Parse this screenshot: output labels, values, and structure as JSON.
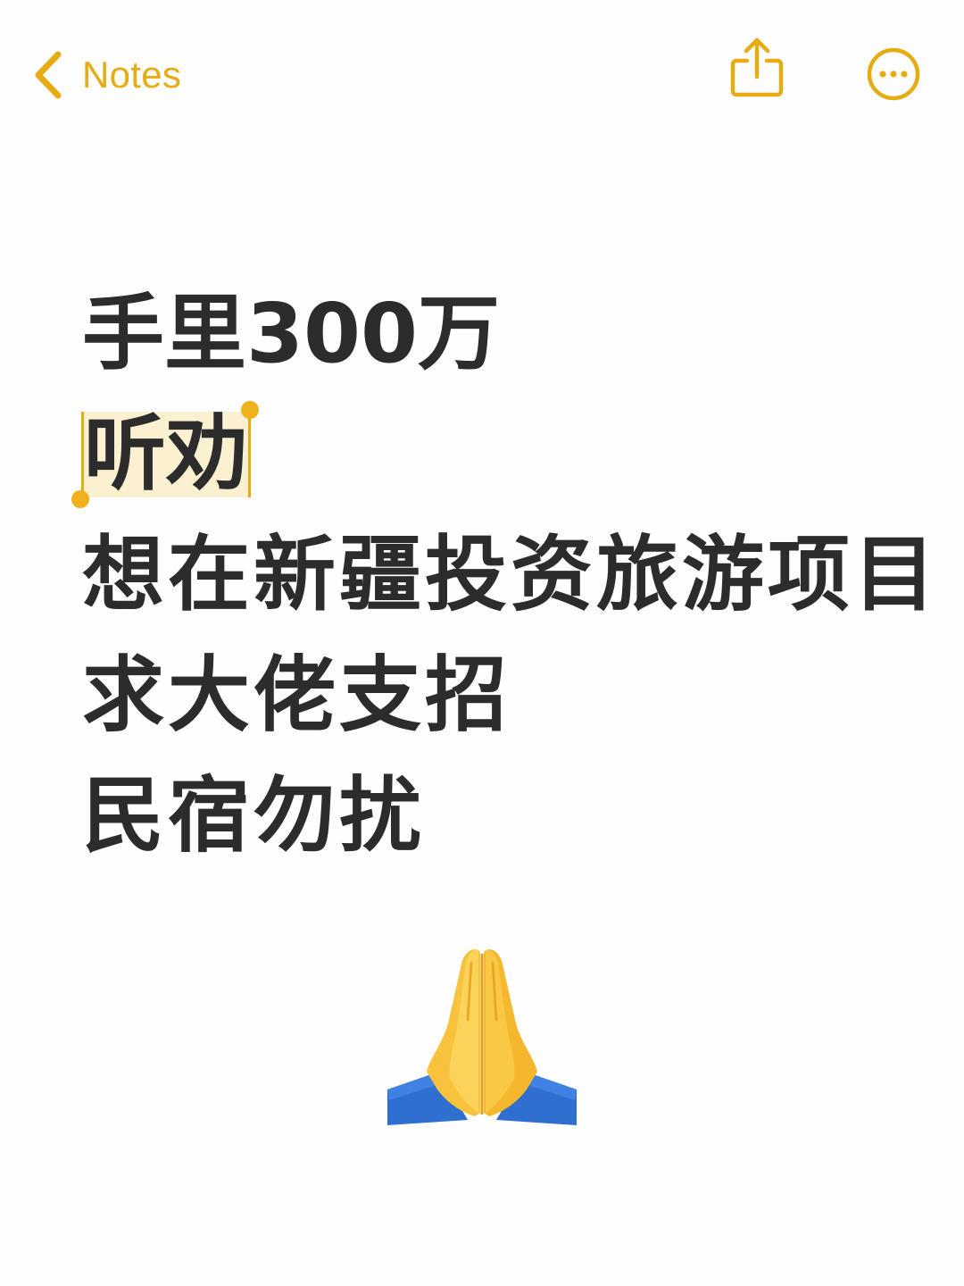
{
  "nav": {
    "back_label": "Notes",
    "back_icon": "chevron-left-icon",
    "share_icon": "share-icon",
    "more_icon": "ellipsis-circle-icon",
    "accent_color": "#e6ac12"
  },
  "note": {
    "lines": [
      "手里300万",
      "听劝",
      "想在新疆投资旅游项目",
      "求大佬支招",
      "民宿勿扰"
    ],
    "selected_line_index": 1,
    "emoji": "🙏",
    "emoji_name": "folded-hands-icon",
    "text_color": "#2c2c2c",
    "selection_color": "#fbf0d0"
  }
}
